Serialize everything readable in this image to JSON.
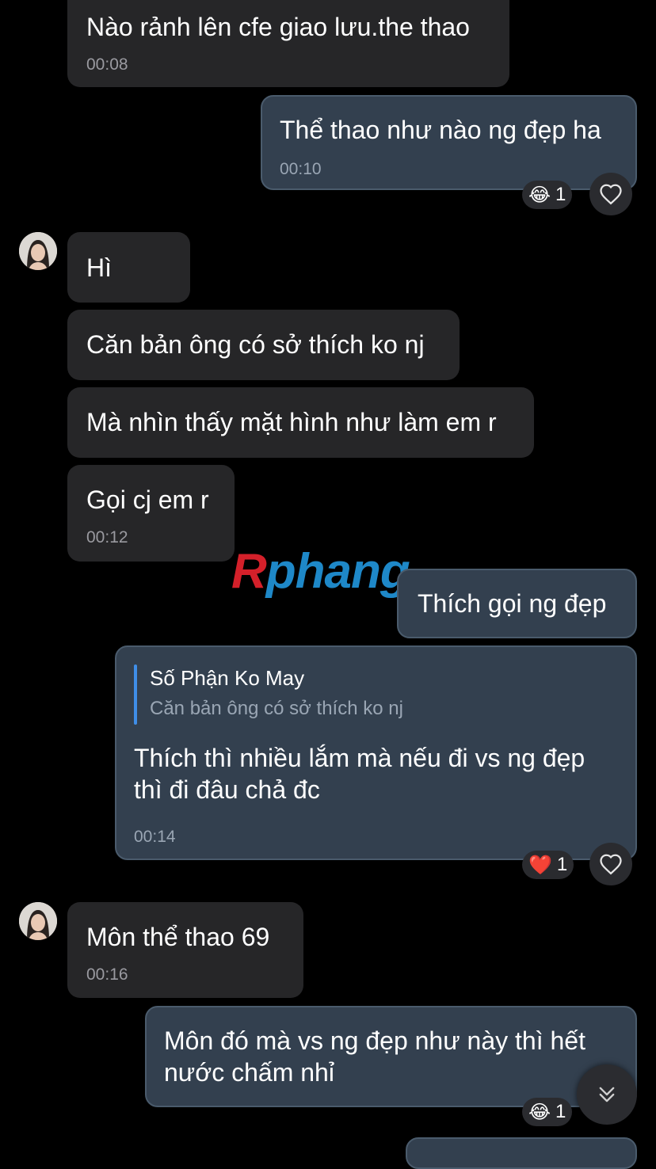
{
  "messages": [
    {
      "text": "Nào rảnh lên cfe giao lưu.the thao",
      "time": "00:08"
    },
    {
      "text": "Thể thao như nào ng đẹp ha",
      "time": "00:10",
      "reaction": {
        "emoji": "😂",
        "count": "1"
      }
    },
    {
      "text": "Hì"
    },
    {
      "text": "Căn bản ông có sở thích ko nj"
    },
    {
      "text": "Mà nhìn thấy mặt hình như làm em r"
    },
    {
      "text": "Gọi cj em r",
      "time": "00:12"
    },
    {
      "text": "Thích gọi ng đẹp"
    },
    {
      "reply": {
        "author": "Số Phận Ko May",
        "quote": "Căn bản ông có sở thích ko nj"
      },
      "line1": "Thích thì nhiều lắm mà nếu đi vs ng đẹp",
      "line2": "thì đi đâu chả đc",
      "time": "00:14",
      "reaction": {
        "emoji": "❤️",
        "count": "1"
      }
    },
    {
      "text": "Môn thể thao 69",
      "time": "00:16"
    },
    {
      "line1": "Môn đó mà vs ng đẹp như này thì hết",
      "line2": "nước chấm nhỉ",
      "reaction": {
        "emoji": "😂",
        "count": "1"
      }
    }
  ],
  "watermark": {
    "part1": "R",
    "part2": "phang"
  },
  "colors": {
    "incoming": "#262628",
    "outgoing": "#33404f",
    "reply_bar": "#3f8ee8",
    "watermark_red": "#d4202a",
    "watermark_blue": "#1e88c8"
  },
  "icons": {
    "like": "heart-outline-icon",
    "scroll": "double-chevron-down-icon",
    "avatar": "avatar-icon"
  }
}
